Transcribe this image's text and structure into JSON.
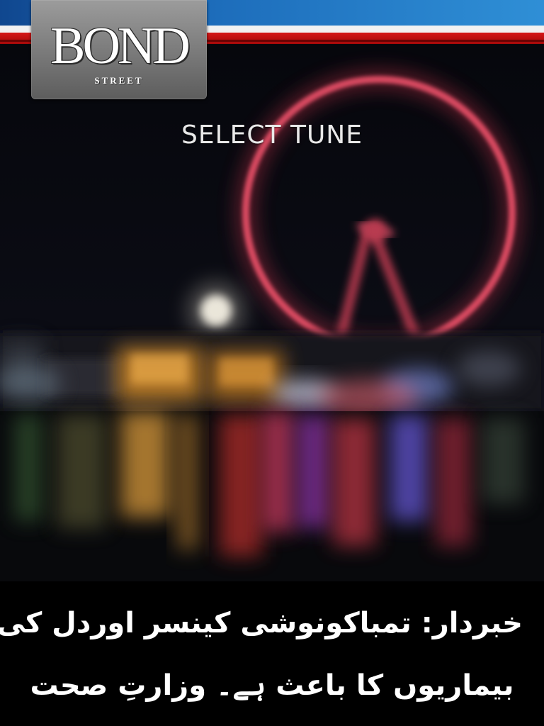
{
  "brand": {
    "logo_word": "BOND",
    "logo_subword": "STREET"
  },
  "screen": {
    "title": "SELECT TUNE"
  },
  "health_warning": {
    "line1": "خبردار: تمباکونوشی کینسر اوردل کی",
    "line2": "بیماریوں کا باعث ہے۔ وزارتِ صحت"
  },
  "colors": {
    "banner_blue": "#1d6dbb",
    "banner_red": "#d51818",
    "banner_white": "#f2f2f2",
    "logo_grey": "#7c7c7c",
    "wheel_red": "#d23a4e",
    "warning_background": "#000000",
    "warning_text": "#ffffff"
  },
  "icons": {
    "background": "london-eye-night-photo"
  }
}
